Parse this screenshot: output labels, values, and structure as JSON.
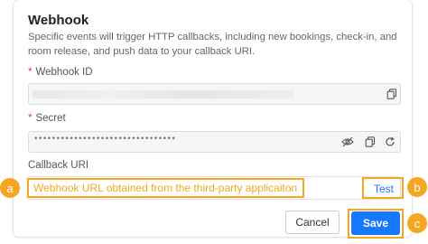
{
  "dialog": {
    "title": "Webhook",
    "description": "Specific events will trigger HTTP callbacks, including new bookings, check-in, and room release, and push data to your callback URI.",
    "required_mark": "*"
  },
  "webhook_id": {
    "label": "Webhook ID",
    "copy_icon": "copy-icon"
  },
  "secret": {
    "label": "Secret",
    "value": "••••••••••••••••••••••••••••••••",
    "icons": [
      "eye-off-icon",
      "copy-icon",
      "refresh-icon"
    ]
  },
  "callback": {
    "label": "Callback URI",
    "value": "Webhook URL obtained from the third-party applicaiton",
    "test_label": "Test"
  },
  "actions": {
    "cancel_label": "Cancel",
    "save_label": "Save"
  },
  "markers": {
    "a": "a",
    "b": "b",
    "c": "c"
  },
  "colors": {
    "accent": "#1677ff",
    "highlight": "#f5a623",
    "required": "#e53935"
  }
}
